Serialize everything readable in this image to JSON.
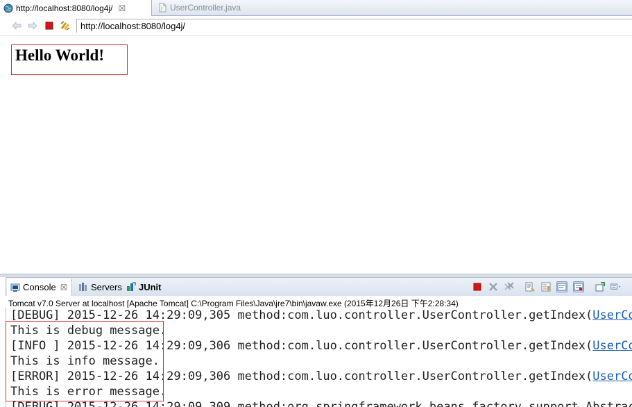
{
  "editor_tabs": [
    {
      "label": "http://localhost:8080/log4j/",
      "active": true,
      "icon": "globe-icon",
      "close": "☒"
    },
    {
      "label": "UserController.java",
      "active": false,
      "icon": "java-file-icon"
    }
  ],
  "browser": {
    "url": "http://localhost:8080/log4j/",
    "buttons": [
      "back-icon",
      "forward-icon",
      "stop-icon",
      "refresh-icon"
    ]
  },
  "page": {
    "heading": "Hello World!"
  },
  "views": {
    "tabs": [
      {
        "label": "Console",
        "icon": "console-icon",
        "close": "☒"
      },
      {
        "label": "Servers",
        "icon": "servers-icon"
      },
      {
        "label": "JUnit",
        "icon": "junit-icon"
      }
    ],
    "toolbar": [
      "terminate-icon",
      "remove-launch-icon",
      "remove-all-terminated-icon",
      "clear-console-icon",
      "scroll-lock-icon",
      "word-wrap-icon",
      "show-console-icon",
      "pin-console-icon",
      "display-selected-console-icon"
    ]
  },
  "console": {
    "info": "Tomcat v7.0 Server at localhost [Apache Tomcat] C:\\Program Files\\Java\\jre7\\bin\\javaw.exe (2015年12月26日 下午2:28:34)",
    "lines": [
      {
        "text": "[DEBUG] 2015-12-26 14:29:09,305 method:com.luo.controller.UserController.getIndex(",
        "link": "UserCont"
      },
      {
        "text": "This is debug message.",
        "link": ""
      },
      {
        "text": "[INFO ] 2015-12-26 14:29:09,306 method:com.luo.controller.UserController.getIndex(",
        "link": "UserCont"
      },
      {
        "text": "This is info message.",
        "link": ""
      },
      {
        "text": "[ERROR] 2015-12-26 14:29:09,306 method:com.luo.controller.UserController.getIndex(",
        "link": "UserCont"
      },
      {
        "text": "This is error message.",
        "link": ""
      },
      {
        "text": "[DEBUG] 2015-12-26 14:29:09,309 method:org.springframework.beans.factory.support.AbstractA",
        "link": ""
      }
    ]
  },
  "colors": {
    "highlight_box": "#d32f2f",
    "link": "#1a5fb4",
    "view_header": "#d9e2ee"
  }
}
